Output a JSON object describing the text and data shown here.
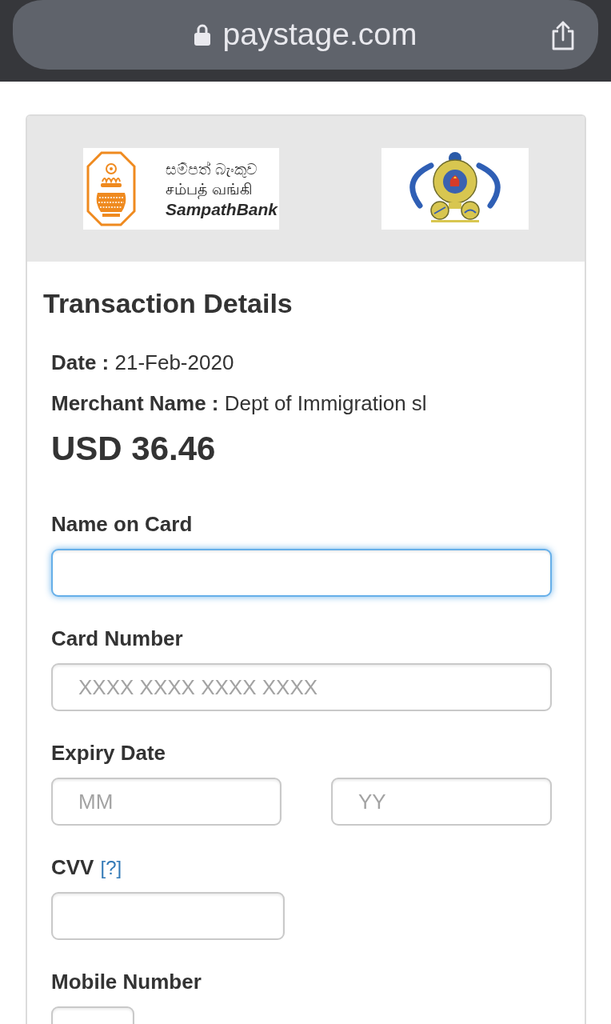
{
  "browser": {
    "url": "paystage.com",
    "secure": true
  },
  "logos": [
    {
      "kind": "bank",
      "script_lines": [
        "සම්පත් බැංකුව",
        "சம்பத் வங்கி"
      ],
      "wordmark": "SampathBank"
    },
    {
      "kind": "emblem"
    }
  ],
  "transaction": {
    "title": "Transaction Details",
    "details": [
      {
        "label": "Date :",
        "value": "21-Feb-2020"
      },
      {
        "label": "Merchant Name :",
        "value": "Dept of Immigration sl"
      }
    ],
    "amount": "USD 36.46"
  },
  "form": {
    "fields": [
      {
        "kind": "full",
        "label": "Name on Card",
        "inputs": [
          {
            "focused": true
          }
        ]
      },
      {
        "kind": "full",
        "label": "Card Number",
        "inputs": [
          {
            "placeholder": "XXXX XXXX XXXX XXXX",
            "focused": false
          }
        ]
      },
      {
        "kind": "split",
        "label": "Expiry Date",
        "inputs": [
          {
            "placeholder": "MM",
            "focused": false
          },
          {
            "placeholder": "YY",
            "focused": false
          }
        ]
      },
      {
        "kind": "half",
        "label": "CVV",
        "help_link": "[?]",
        "inputs": [
          {
            "focused": false
          }
        ]
      },
      {
        "kind": "short",
        "label": "Mobile Number",
        "inputs": [
          {
            "focused": false
          }
        ]
      }
    ]
  }
}
